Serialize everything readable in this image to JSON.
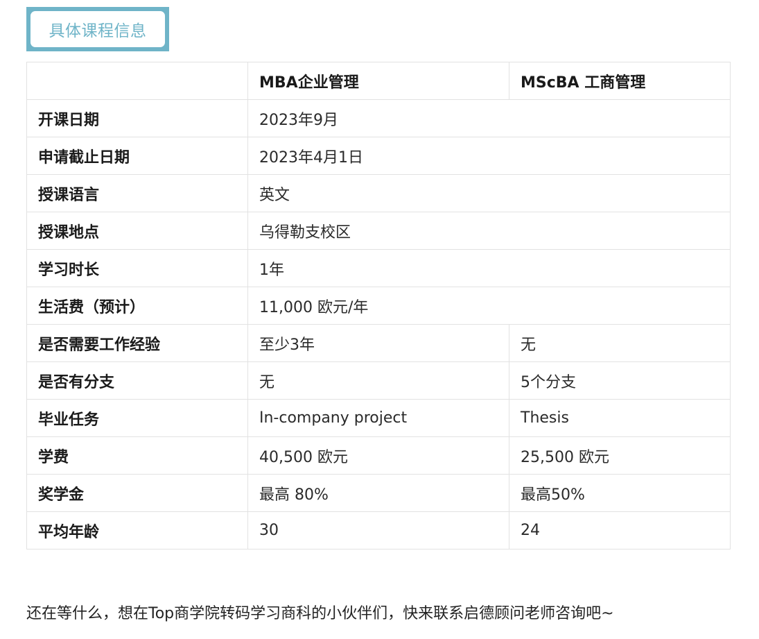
{
  "section_tag": "具体课程信息",
  "table": {
    "columns": [
      "",
      "MBA企业管理",
      "MScBA 工商管理"
    ],
    "rows": [
      {
        "label": "开课日期",
        "shared": "2023年9月"
      },
      {
        "label": "申请截止日期",
        "shared": "2023年4月1日"
      },
      {
        "label": "授课语言",
        "shared": "英文"
      },
      {
        "label": "授课地点",
        "shared": "乌得勒支校区"
      },
      {
        "label": "学习时长",
        "shared": "1年"
      },
      {
        "label": "生活费（预计）",
        "shared": "11,000 欧元/年"
      },
      {
        "label": "是否需要工作经验",
        "mba": "至少3年",
        "mscba": "无"
      },
      {
        "label": "是否有分支",
        "mba": "无",
        "mscba": "5个分支"
      },
      {
        "label": "毕业任务",
        "mba": "In-company project",
        "mscba": "Thesis"
      },
      {
        "label": "学费",
        "mba": "40,500 欧元",
        "mscba": "25,500 欧元"
      },
      {
        "label": "奖学金",
        "mba": "最高 80%",
        "mscba": "最高50%"
      },
      {
        "label": "平均年龄",
        "mba": "30",
        "mscba": "24"
      }
    ]
  },
  "closing_text": "还在等什么，想在Top商学院转码学习商科的小伙伴们，快来联系启德顾问老师咨询吧~",
  "colors": {
    "accent": "#6fb4c8",
    "border": "#e2e2e2",
    "text": "#222222"
  }
}
